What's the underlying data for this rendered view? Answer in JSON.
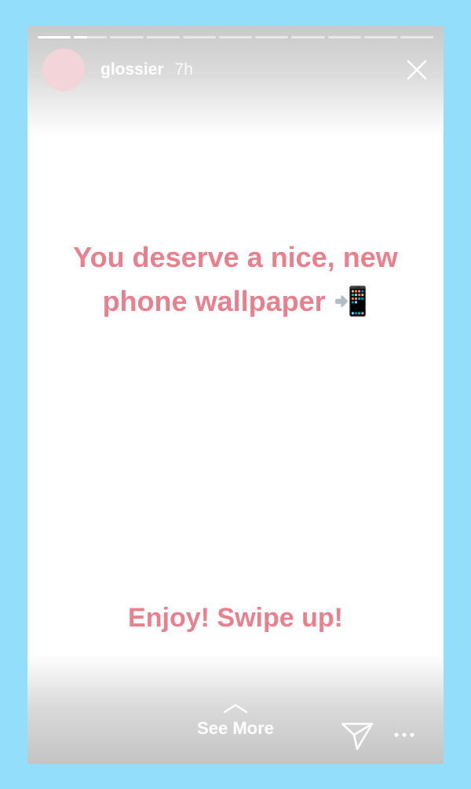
{
  "story": {
    "segments_total": 11,
    "segment_progress": [
      1,
      0.4,
      0,
      0,
      0,
      0,
      0,
      0,
      0,
      0,
      0
    ],
    "username": "glossier",
    "time_ago": "7h",
    "headline_line1": "You deserve a nice, new",
    "headline_line2": "phone wallpaper 📲",
    "cta": "Enjoy! Swipe up!",
    "see_more_label": "See More"
  },
  "icons": {
    "close": "close-icon",
    "chevron": "chevron-up-icon",
    "send": "paper-plane-icon",
    "more": "more-options-icon"
  },
  "colors": {
    "frame_bg": "#93dffb",
    "text_pink": "#e8808e",
    "avatar": "#f2d4d9"
  }
}
